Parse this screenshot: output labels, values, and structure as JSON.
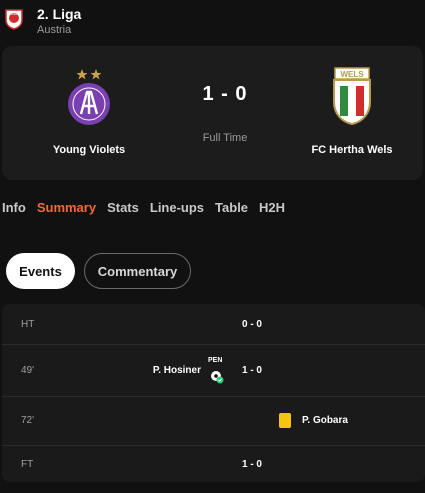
{
  "league": {
    "name": "2. Liga",
    "country": "Austria",
    "logo_icon": "2-liga-logo-icon",
    "logo_text": "2.LIGA"
  },
  "match": {
    "home_team": "Young Violets",
    "away_team": "FC Hertha Wels",
    "home_crest_icon": "young-violets-crest-icon",
    "away_crest_icon": "fc-hertha-wels-crest-icon",
    "away_crest_text": "WELS",
    "score": "1 - 0",
    "status": "Full Time"
  },
  "tabs": [
    "Info",
    "Summary",
    "Stats",
    "Line-ups",
    "Table",
    "H2H"
  ],
  "active_tab": "Summary",
  "subtabs": {
    "events": "Events",
    "commentary": "Commentary",
    "active": "Events"
  },
  "events": [
    {
      "minute": "HT",
      "score": "0 - 0"
    },
    {
      "minute": "49'",
      "player": "P. Hosiner",
      "tag": "PEN",
      "score": "1 - 0",
      "icon": "penalty-goal-ball-icon"
    },
    {
      "minute": "72'",
      "player": "P. Gobara",
      "icon": "yellow-card-icon"
    },
    {
      "minute": "FT",
      "score": "1 - 0"
    }
  ],
  "colors": {
    "background": "#111111",
    "card": "#1c1c1c",
    "accent": "#f26a2e",
    "yellow_card": "#f6c40f",
    "young_violets_purple": "#7a3fb0",
    "league_red": "#d22c2c"
  }
}
